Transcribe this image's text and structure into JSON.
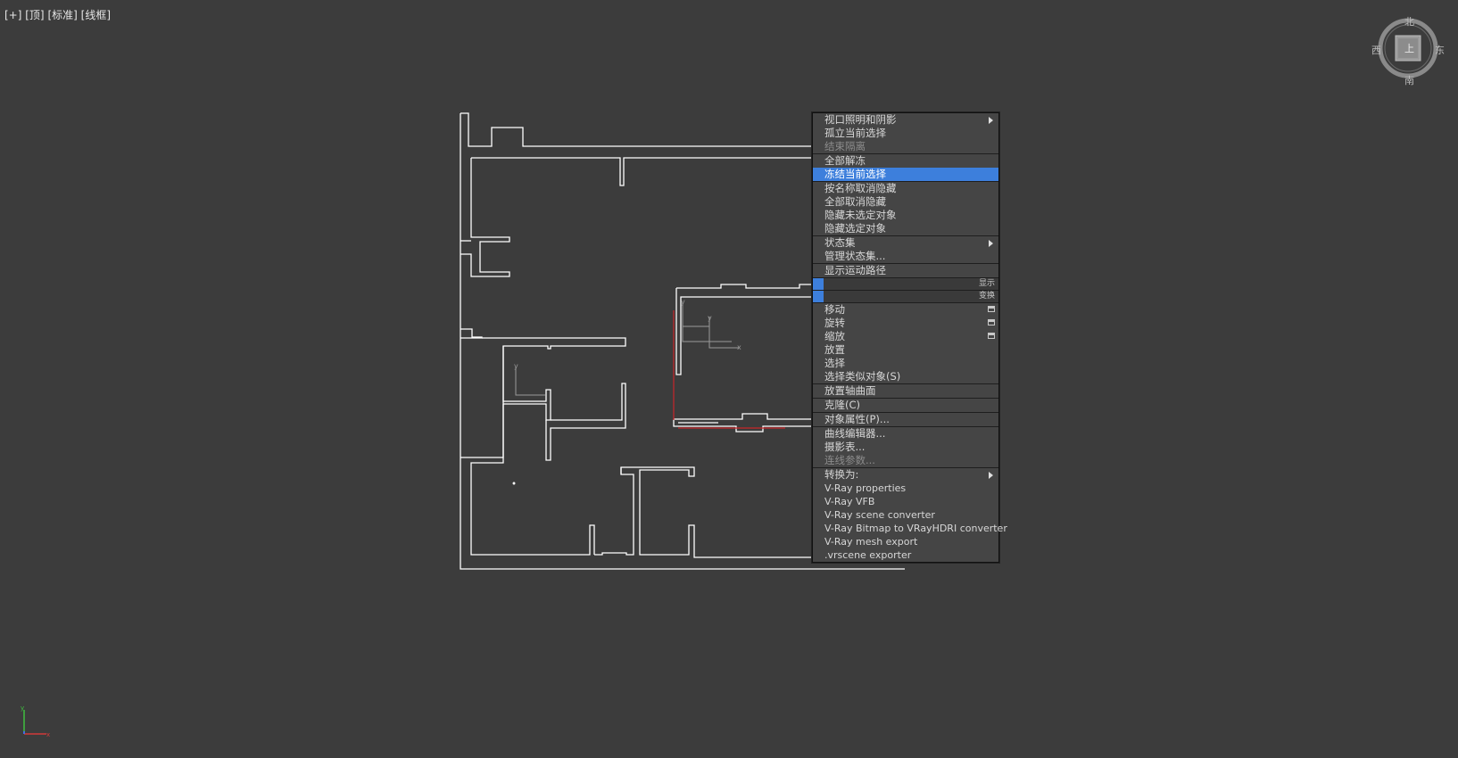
{
  "viewport": {
    "label_plus": "[+]",
    "label_view": "[顶]",
    "label_shading": "[标准]",
    "label_mode": "[线框]"
  },
  "viewcube": {
    "north": "北",
    "south": "南",
    "east": "东",
    "west": "西",
    "face": "上"
  },
  "axis_tripod": {
    "y": "y",
    "x": "x"
  },
  "quad_menu": {
    "display_title": "显示",
    "transform_title": "变换",
    "display_items": [
      {
        "label": "视口照明和阴影",
        "submenu": true
      },
      {
        "label": "孤立当前选择"
      },
      {
        "label": "结束隔离",
        "disabled": true
      },
      {
        "label": "全部解冻"
      },
      {
        "label": "冻结当前选择",
        "selected": true
      },
      {
        "label": "按名称取消隐藏"
      },
      {
        "label": "全部取消隐藏"
      },
      {
        "label": "隐藏未选定对象"
      },
      {
        "label": "隐藏选定对象"
      },
      {
        "label": "状态集",
        "submenu": true
      },
      {
        "label": "管理状态集..."
      },
      {
        "label": "显示运动路径"
      }
    ],
    "transform_items": [
      {
        "label": "移动"
      },
      {
        "label": "旋转"
      },
      {
        "label": "缩放"
      },
      {
        "label": "放置"
      },
      {
        "label": "选择"
      },
      {
        "label": "选择类似对象(S)"
      },
      {
        "label": "放置轴曲面"
      },
      {
        "label": "克隆(C)"
      },
      {
        "label": "对象属性(P)..."
      },
      {
        "label": "曲线编辑器..."
      },
      {
        "label": "摄影表..."
      },
      {
        "label": "连线参数...",
        "disabled": true
      },
      {
        "label": "转换为:",
        "submenu": true
      },
      {
        "label": "V-Ray properties"
      },
      {
        "label": "V-Ray VFB"
      },
      {
        "label": "V-Ray scene converter"
      },
      {
        "label": "V-Ray Bitmap to VRayHDRI converter"
      },
      {
        "label": "V-Ray mesh export"
      },
      {
        "label": ".vrscene exporter"
      }
    ]
  },
  "colors": {
    "viewport_bg": "#3c3c3c",
    "menu_bg": "#454545",
    "highlight": "#3d7fdc",
    "wall_lines": "#ffffff",
    "selection_red": "#c8262a"
  }
}
